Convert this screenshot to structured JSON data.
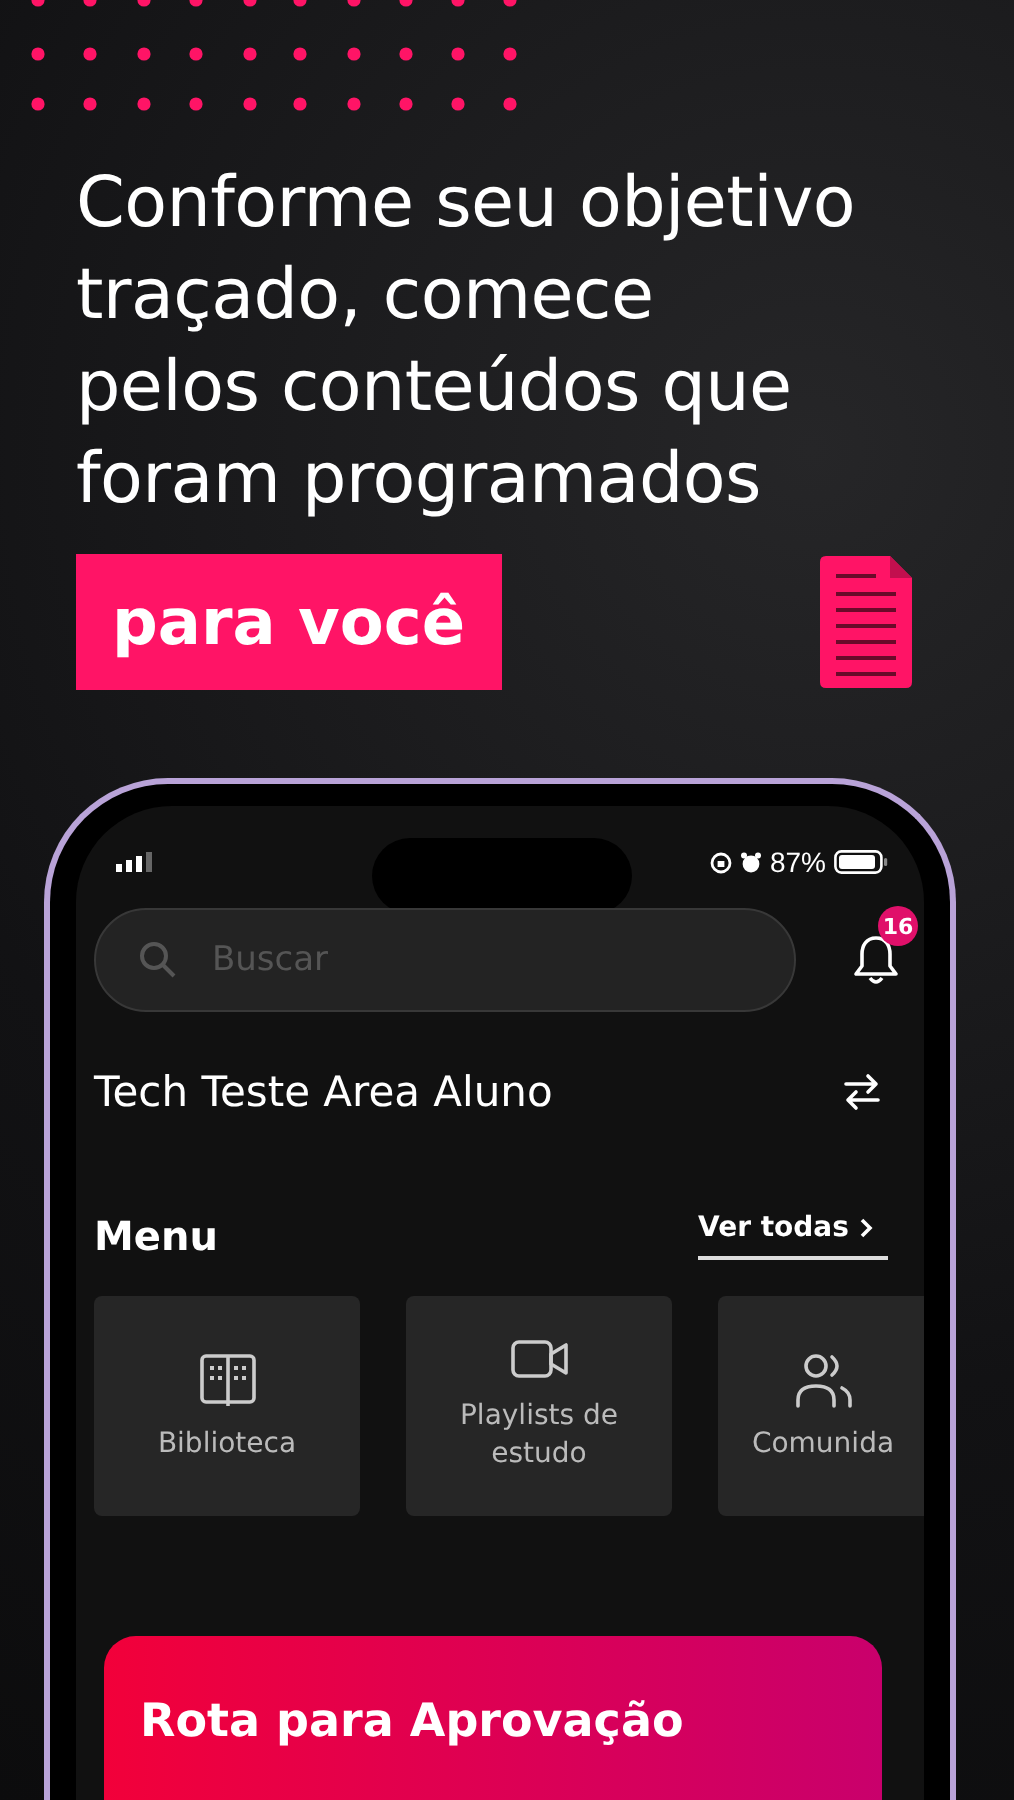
{
  "headline": {
    "lines": [
      "Conforme seu objetivo",
      "traçado, comece",
      "pelos conteúdos que",
      "foram programados"
    ],
    "highlight": "para você"
  },
  "phone": {
    "status_bar": {
      "battery_text": "87%"
    },
    "search": {
      "placeholder": "Buscar"
    },
    "notifications": {
      "count": "16"
    },
    "title": "Tech Teste Area Aluno",
    "menu": {
      "title": "Menu",
      "see_all": "Ver todas",
      "items": [
        {
          "kind": "book",
          "label": "Biblioteca"
        },
        {
          "kind": "video",
          "label": "Playlists de estudo"
        },
        {
          "kind": "people",
          "label": "Comunida"
        }
      ]
    },
    "banner": {
      "title": "Rota para Aprovação"
    }
  }
}
